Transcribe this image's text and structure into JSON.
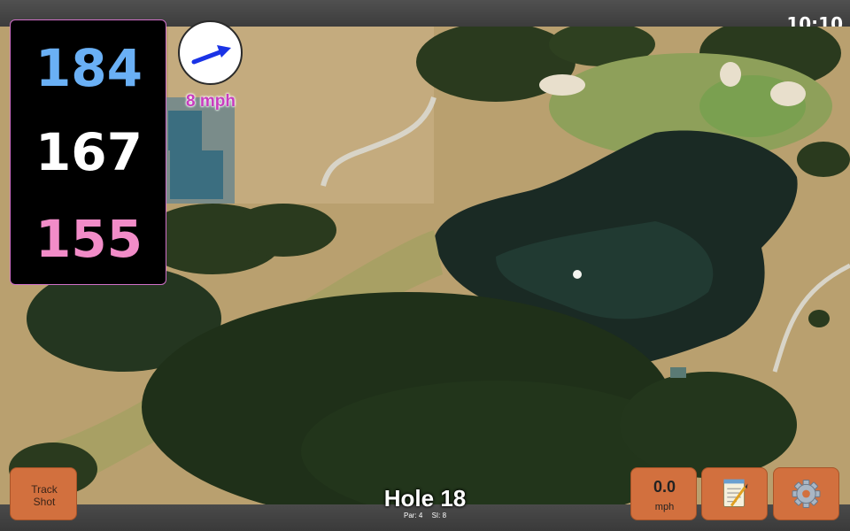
{
  "status": {
    "time": "10:10"
  },
  "yardages": {
    "back": "184",
    "middle": "167",
    "front": "155"
  },
  "wind": {
    "speed": "8 mph",
    "icon": "wind-direction-arrow"
  },
  "hole": {
    "title": "Hole 18",
    "par": "Par: 4",
    "si": "SI: 8"
  },
  "buttons": {
    "track_line1": "Track",
    "track_line2": "Shot",
    "speed_value": "0.0",
    "speed_unit": "mph",
    "scorecard_icon": "notepad-icon",
    "settings_icon": "gear-icon"
  },
  "colors": {
    "back_yardage": "#6ab0f5",
    "middle_yardage": "#ffffff",
    "front_yardage": "#f28cc8",
    "button_bg": "#d2703e",
    "wind_text": "#c83cbe"
  }
}
